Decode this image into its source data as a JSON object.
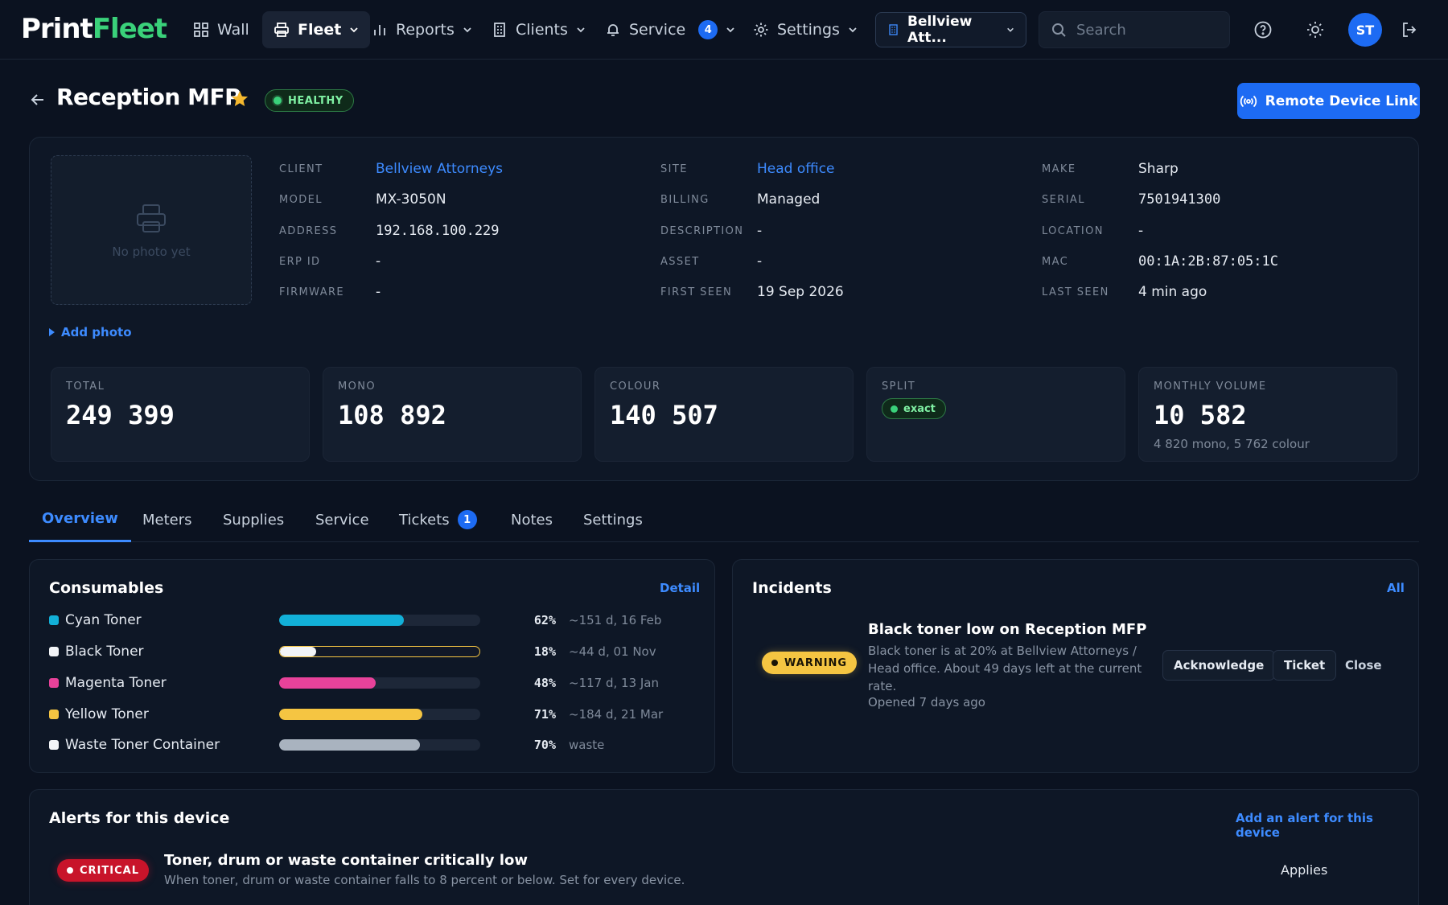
{
  "app": {
    "logo_part1": "Print",
    "logo_part2": "Fleet"
  },
  "nav": {
    "wall": "Wall",
    "fleet": "Fleet",
    "reports": "Reports",
    "clients": "Clients",
    "service": "Service",
    "service_count": "4",
    "settings": "Settings",
    "client_selector": "Bellview Att...",
    "search_placeholder": "Search",
    "avatar_initials": "ST"
  },
  "header": {
    "title": "Reception MFP",
    "status": "HEALTHY",
    "remote_button": "Remote Device Link"
  },
  "device": {
    "photo_placeholder": "No photo yet",
    "add_photo": "Add photo",
    "fields": {
      "client_label": "CLIENT",
      "client": "Bellview Attorneys",
      "model_label": "MODEL",
      "model": "MX-3050N",
      "address_label": "ADDRESS",
      "address": "192.168.100.229",
      "erp_label": "ERP ID",
      "erp": "-",
      "firmware_label": "FIRMWARE",
      "firmware": "-",
      "site_label": "SITE",
      "site": "Head office",
      "billing_label": "BILLING",
      "billing": "Managed",
      "description_label": "DESCRIPTION",
      "description": "-",
      "asset_label": "ASSET",
      "asset": "-",
      "first_seen_label": "FIRST SEEN",
      "first_seen": "19 Sep 2026",
      "make_label": "MAKE",
      "make": "Sharp",
      "serial_label": "SERIAL",
      "serial": "7501941300",
      "location_label": "LOCATION",
      "location": "-",
      "mac_label": "MAC",
      "mac": "00:1A:2B:87:05:1C",
      "last_seen_label": "LAST SEEN",
      "last_seen": "4 min ago"
    },
    "stats": {
      "total_label": "TOTAL",
      "total": "249 399",
      "mono_label": "MONO",
      "mono": "108 892",
      "colour_label": "COLOUR",
      "colour": "140 507",
      "split_label": "SPLIT",
      "split": "exact",
      "monthly_label": "MONTHLY VOLUME",
      "monthly": "10 582",
      "monthly_sub": "4 820 mono, 5 762 colour"
    }
  },
  "tabs": [
    {
      "label": "Overview"
    },
    {
      "label": "Meters"
    },
    {
      "label": "Supplies"
    },
    {
      "label": "Service"
    },
    {
      "label": "Tickets",
      "count": "1"
    },
    {
      "label": "Notes"
    },
    {
      "label": "Settings"
    }
  ],
  "consumables": {
    "title": "Consumables",
    "detail_link": "Detail",
    "items": [
      {
        "name": "Cyan Toner",
        "level": 0.62,
        "pct": "62%",
        "eta": "~151 d, 16 Feb",
        "color": "#12b0d8"
      },
      {
        "name": "Black Toner",
        "level": 0.18,
        "pct": "18%",
        "eta": "~44 d, 01 Nov",
        "color": "#f2f4f7"
      },
      {
        "name": "Magenta Toner",
        "level": 0.48,
        "pct": "48%",
        "eta": "~117 d, 13 Jan",
        "color": "#e8429a"
      },
      {
        "name": "Yellow Toner",
        "level": 0.71,
        "pct": "71%",
        "eta": "~184 d, 21 Mar",
        "color": "#f5c542"
      },
      {
        "name": "Waste Toner Container",
        "level": 0.7,
        "pct": "70%",
        "eta": "waste",
        "color": "#a9b3bf"
      }
    ]
  },
  "incidents": {
    "title": "Incidents",
    "all_link": "All",
    "severity": "WARNING",
    "heading": "Black toner low on Reception MFP",
    "description": "Black toner is at 20% at Bellview Attorneys / Head office. About 49 days left at the current rate.",
    "opened": "Opened 7 days ago",
    "acknowledge": "Acknowledge",
    "ticket": "Ticket",
    "close": "Close"
  },
  "alerts": {
    "title": "Alerts for this device",
    "add_link": "Add an alert for this device",
    "severity": "CRITICAL",
    "heading": "Toner, drum or waste container critically low",
    "description": "When toner, drum or waste container falls to 8 percent or below. Set for every device.",
    "applies": "Applies"
  },
  "colors": {
    "accent": "#1d6bf3",
    "link": "#3d8bff",
    "healthy": "#3ad17a",
    "warning": "#f5c542",
    "critical": "#c8142a"
  }
}
